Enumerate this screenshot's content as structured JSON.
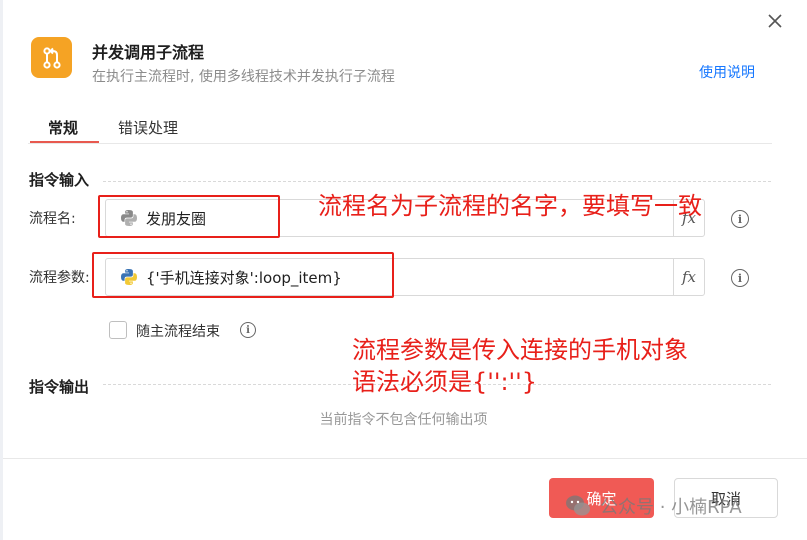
{
  "dialog": {
    "title": "并发调用子流程",
    "subtitle": "在执行主流程时, 使用多线程技术并发执行子流程",
    "help_link": "使用说明"
  },
  "tabs": [
    {
      "label": "常规",
      "active": true
    },
    {
      "label": "错误处理",
      "active": false
    }
  ],
  "sections": {
    "input_title": "指令输入",
    "output_title": "指令输出",
    "output_empty": "当前指令不包含任何输出项"
  },
  "fields": {
    "flow_name": {
      "label": "流程名:",
      "value": "发朋友圈"
    },
    "flow_params": {
      "label": "流程参数:",
      "value": "{'手机连接对象':loop_item}"
    },
    "fx_label": "fx"
  },
  "checkbox": {
    "label": "随主流程结束",
    "checked": false
  },
  "footer": {
    "ok_label": "确定",
    "cancel_label": "取消"
  },
  "annotations": {
    "note1": "流程名为子流程的名字，要填写一致",
    "note2_line1": "流程参数是传入连接的手机对象",
    "note2_line2": "语法必须是{'':''}",
    "color": "#e8201a"
  },
  "watermark": {
    "text": "公众号 · 小楠RPA"
  },
  "colors": {
    "accent": "#f05a55",
    "tab_underline": "#e8594f",
    "app_icon": "#f5a324",
    "link": "#1677ff"
  },
  "icons": {
    "close": "close-icon",
    "app": "flow-branch-icon",
    "python": "python-icon",
    "info": "info-icon",
    "watermark": "wechat-icon"
  }
}
